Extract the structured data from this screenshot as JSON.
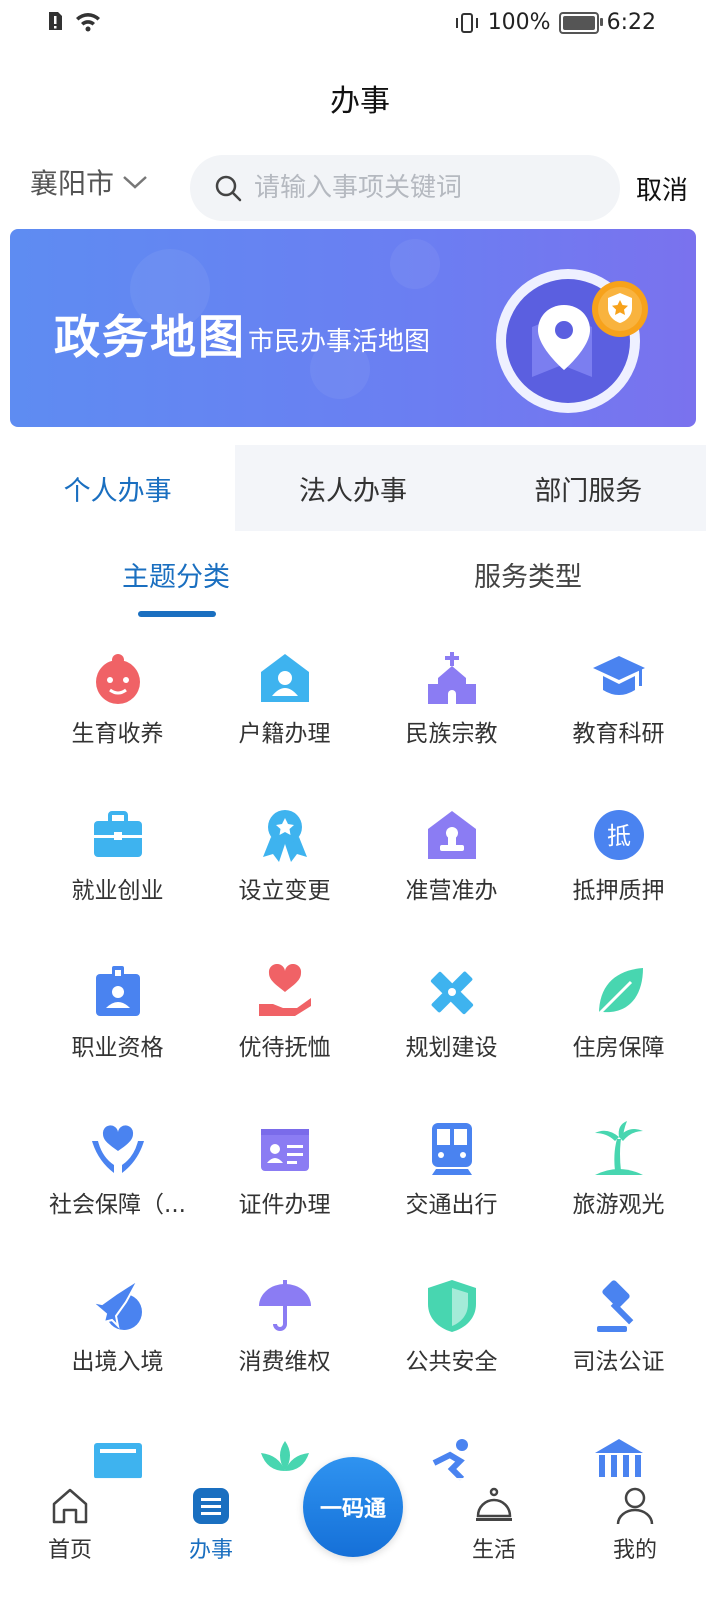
{
  "status_bar": {
    "battery": "100%",
    "time": "6:22"
  },
  "title": "办事",
  "search": {
    "city": "襄阳市",
    "placeholder": "请输入事项关键词",
    "cancel": "取消"
  },
  "banner": {
    "title": "政务地图",
    "subtitle": "市民办事活地图"
  },
  "tabs": [
    {
      "label": "个人办事",
      "active": true
    },
    {
      "label": "法人办事",
      "active": false
    },
    {
      "label": "部门服务",
      "active": false
    }
  ],
  "subtabs": [
    {
      "label": "主题分类",
      "active": true
    },
    {
      "label": "服务类型",
      "active": false
    }
  ],
  "categories": [
    {
      "label": "生育收养",
      "icon": "baby-icon",
      "color": "#f06266"
    },
    {
      "label": "户籍办理",
      "icon": "house-person-icon",
      "color": "#3eb3ef"
    },
    {
      "label": "民族宗教",
      "icon": "church-icon",
      "color": "#8b7cf3"
    },
    {
      "label": "教育科研",
      "icon": "graduation-cap-icon",
      "color": "#4a83f0"
    },
    {
      "label": "就业创业",
      "icon": "briefcase-icon",
      "color": "#3eb3ef"
    },
    {
      "label": "设立变更",
      "icon": "award-ribbon-icon",
      "color": "#3eb3ef"
    },
    {
      "label": "准营准办",
      "icon": "stamp-house-icon",
      "color": "#8b7cf3"
    },
    {
      "label": "抵押质押",
      "icon": "mortgage-icon",
      "color": "#4a83f0"
    },
    {
      "label": "职业资格",
      "icon": "id-badge-icon",
      "color": "#4a83f0"
    },
    {
      "label": "优待抚恤",
      "icon": "heart-hand-icon",
      "color": "#f06266"
    },
    {
      "label": "规划建设",
      "icon": "ruler-pencil-icon",
      "color": "#3eb3ef"
    },
    {
      "label": "住房保障",
      "icon": "leaf-icon",
      "color": "#48d6b0"
    },
    {
      "label": "社会保障（...",
      "icon": "heart-hands-icon",
      "color": "#4a83f0"
    },
    {
      "label": "证件办理",
      "icon": "id-card-icon",
      "color": "#8b7cf3"
    },
    {
      "label": "交通出行",
      "icon": "train-icon",
      "color": "#4a83f0"
    },
    {
      "label": "旅游观光",
      "icon": "palm-tree-icon",
      "color": "#48d6b0"
    },
    {
      "label": "出境入境",
      "icon": "airplane-globe-icon",
      "color": "#4a83f0"
    },
    {
      "label": "消费维权",
      "icon": "umbrella-icon",
      "color": "#8b7cf3"
    },
    {
      "label": "公共安全",
      "icon": "shield-icon",
      "color": "#48d6b0"
    },
    {
      "label": "司法公证",
      "icon": "gavel-icon",
      "color": "#4a83f0"
    }
  ],
  "bottom_nav": {
    "home": "首页",
    "affairs": "办事",
    "center": "一码通",
    "life": "生活",
    "mine": "我的"
  },
  "accent_color": "#1a6fc0"
}
